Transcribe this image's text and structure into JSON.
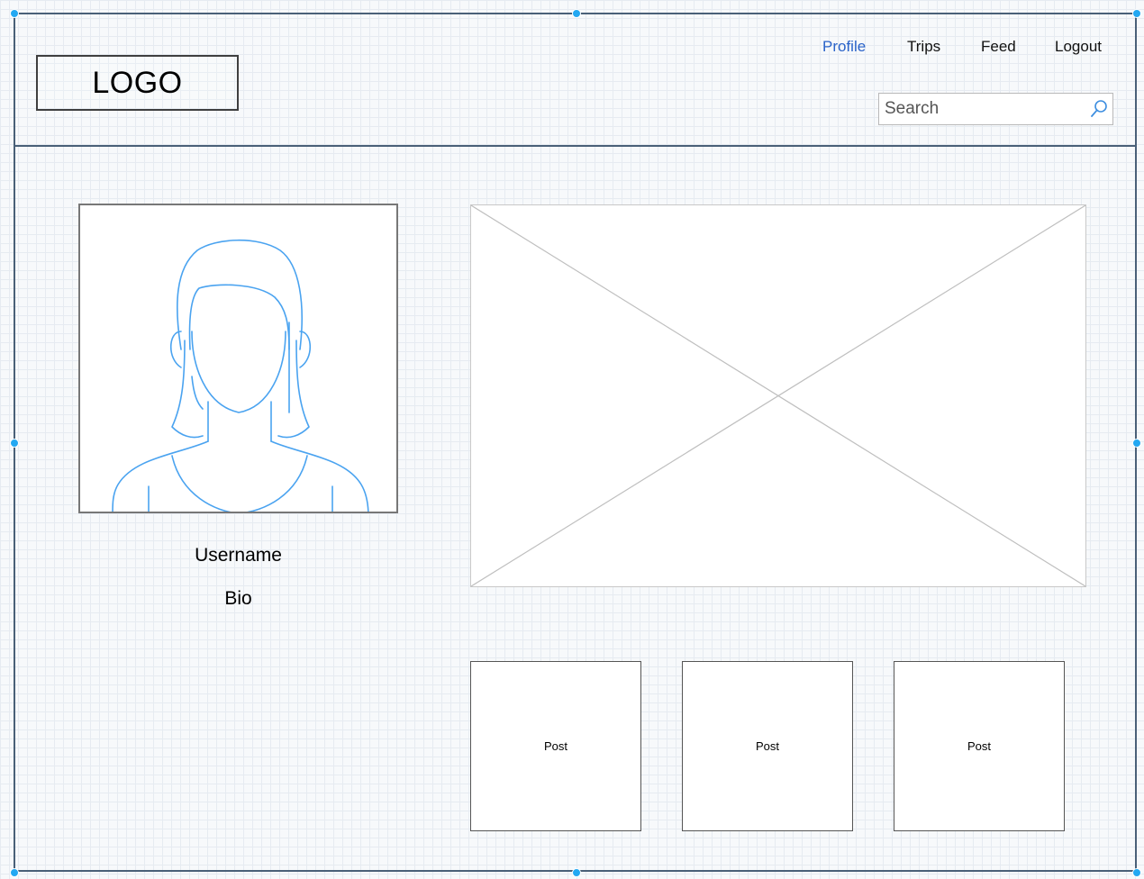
{
  "header": {
    "logo_text": "LOGO",
    "nav": {
      "profile": "Profile",
      "trips": "Trips",
      "feed": "Feed",
      "logout": "Logout"
    },
    "search": {
      "placeholder": "Search",
      "value": ""
    }
  },
  "profile": {
    "username": "Username",
    "bio": "Bio"
  },
  "posts": [
    {
      "label": "Post"
    },
    {
      "label": "Post"
    },
    {
      "label": "Post"
    }
  ],
  "colors": {
    "active_nav": "#2a63c9",
    "sketch_line": "#4aa3f0",
    "selection_handle": "#23a8f2",
    "frame_border": "#4a6078"
  },
  "icons": {
    "search": "search-icon",
    "avatar": "female-avatar-sketch",
    "image": "image-placeholder-cross"
  }
}
